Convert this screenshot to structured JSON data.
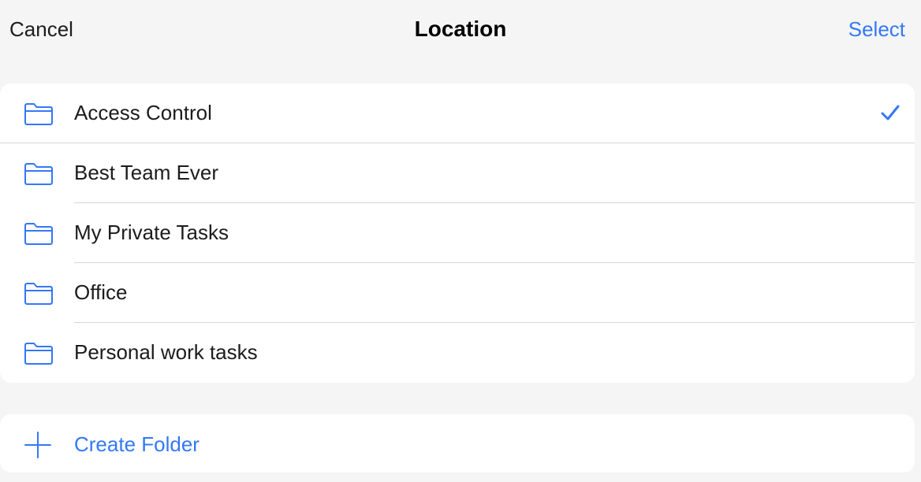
{
  "nav": {
    "cancel_label": "Cancel",
    "title": "Location",
    "select_label": "Select"
  },
  "folders": [
    {
      "label": "Access Control",
      "icon": "folder-icon",
      "selected": true
    },
    {
      "label": "Best Team Ever",
      "icon": "folder-icon",
      "selected": false
    },
    {
      "label": "My Private Tasks",
      "icon": "folder-icon",
      "selected": false
    },
    {
      "label": "Office",
      "icon": "folder-icon",
      "selected": false
    },
    {
      "label": "Personal work tasks",
      "icon": "folder-icon",
      "selected": false
    }
  ],
  "create": {
    "label": "Create Folder",
    "icon": "plus-icon"
  },
  "colors": {
    "accent": "#3478f6",
    "background": "#f5f5f5",
    "card": "#ffffff",
    "separator": "#d6d6d8"
  }
}
